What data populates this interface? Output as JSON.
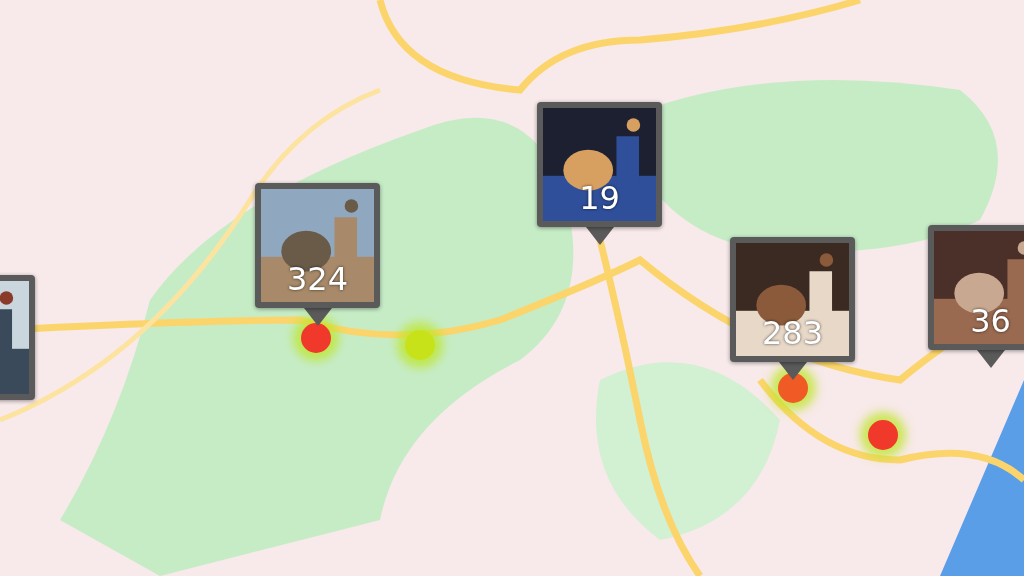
{
  "markers": [
    {
      "kind": "picture"
    },
    {
      "kind": "picture",
      "count": "324"
    },
    {
      "kind": "picture",
      "count": "19"
    },
    {
      "kind": "picture",
      "count": "283"
    },
    {
      "kind": "picture",
      "count": "36"
    }
  ],
  "heat_spots": [
    {
      "color": "#f0382b"
    },
    {
      "color": "#c8e21a"
    },
    {
      "color": "#f05a24"
    },
    {
      "color": "#f0382b"
    }
  ]
}
